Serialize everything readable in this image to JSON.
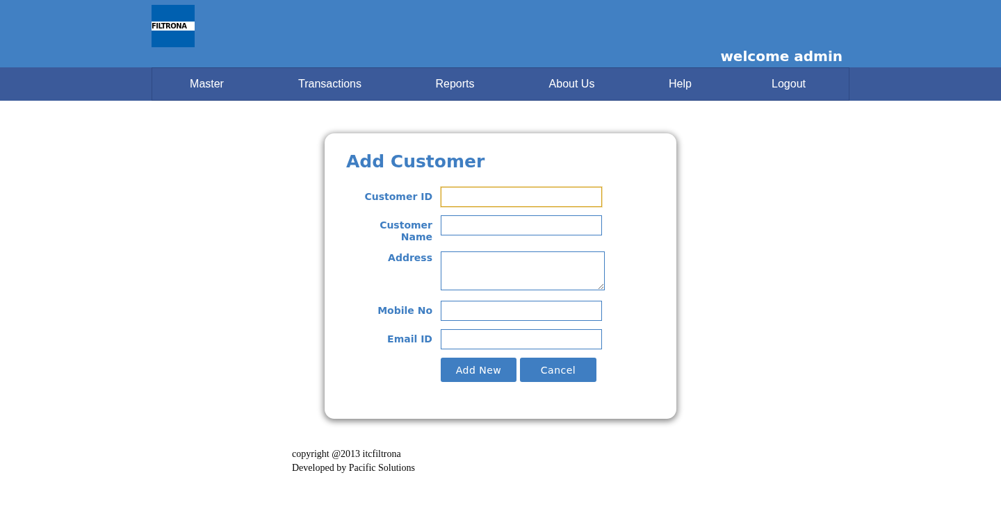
{
  "header": {
    "logo": "FILTRONA",
    "welcome": "welcome admin"
  },
  "nav": [
    {
      "label": "Master"
    },
    {
      "label": "Transactions"
    },
    {
      "label": "Reports"
    },
    {
      "label": "About Us"
    },
    {
      "label": "Help"
    },
    {
      "label": "Logout"
    }
  ],
  "form": {
    "title": "Add Customer",
    "fields": [
      {
        "label": "Customer ID",
        "kind": "input",
        "focused": true
      },
      {
        "label": "Customer Name",
        "kind": "input",
        "focused": false
      },
      {
        "label": "Address",
        "kind": "textarea",
        "focused": false
      },
      {
        "label": "Mobile No",
        "kind": "input",
        "focused": false
      },
      {
        "label": "Email ID",
        "kind": "input",
        "focused": false
      }
    ],
    "buttons": [
      "Add New",
      "Cancel"
    ]
  },
  "footer": [
    "copyright @2013 itcfiltrona",
    "Developed by Pacific Solutions"
  ]
}
